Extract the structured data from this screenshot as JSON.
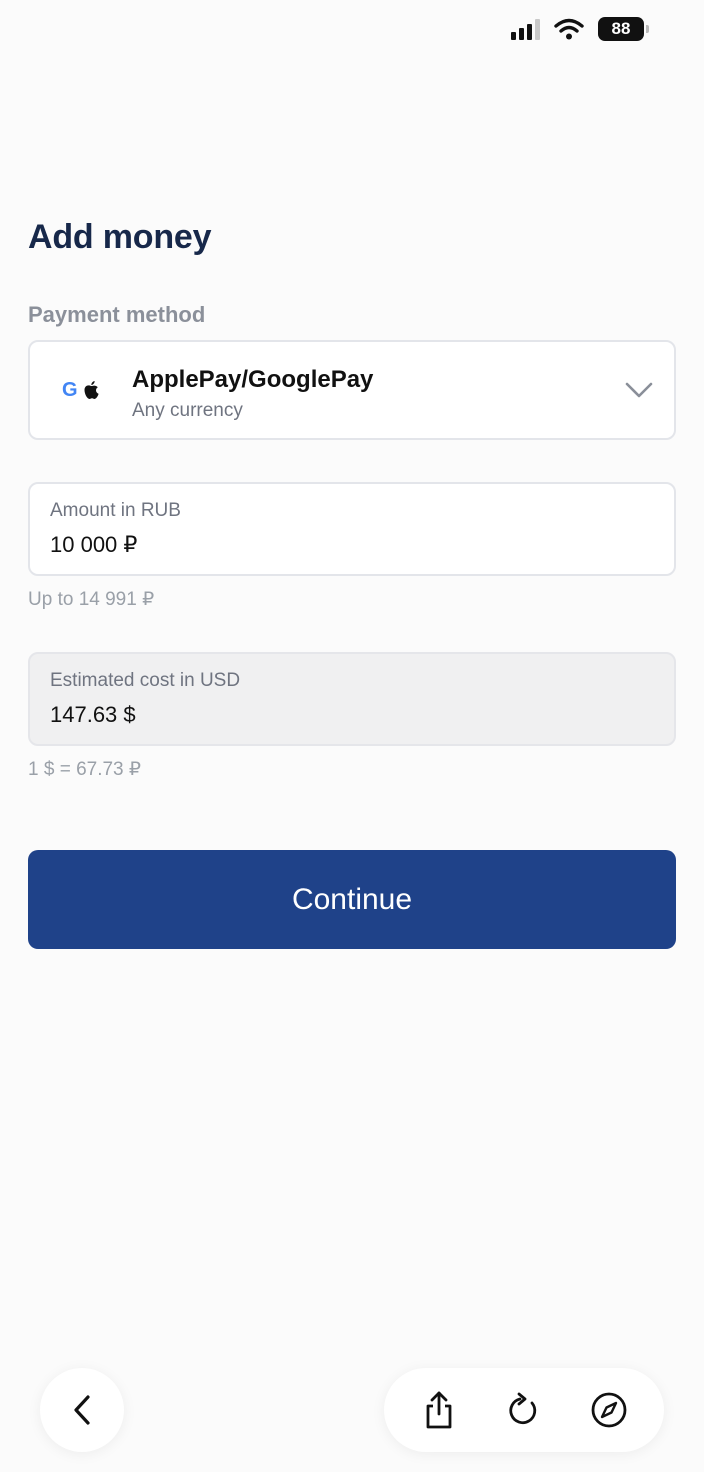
{
  "status_bar": {
    "battery_level": "88",
    "signal_icon": "cellular-signal-icon",
    "wifi_icon": "wifi-icon"
  },
  "page": {
    "title": "Add money"
  },
  "payment": {
    "section_label": "Payment method",
    "method_name": "ApplePay/GooglePay",
    "method_subtitle": "Any currency",
    "google_mark": "G",
    "icons": [
      "google-logo-icon",
      "apple-logo-icon",
      "chevron-down-icon"
    ]
  },
  "amount": {
    "label": "Amount in RUB",
    "value": "10 000 ₽",
    "hint": "Up to 14 991 ₽"
  },
  "estimate": {
    "label": "Estimated cost in USD",
    "value": "147.63 $",
    "rate": "1 $ = 67.73 ₽"
  },
  "actions": {
    "continue_label": "Continue"
  },
  "browser_nav": {
    "icons": [
      "back-icon",
      "share-icon",
      "reload-icon",
      "compass-icon"
    ]
  },
  "colors": {
    "primary": "#1f4289",
    "title": "#17284a",
    "muted": "#8b909a",
    "background": "#fbfbfb"
  }
}
